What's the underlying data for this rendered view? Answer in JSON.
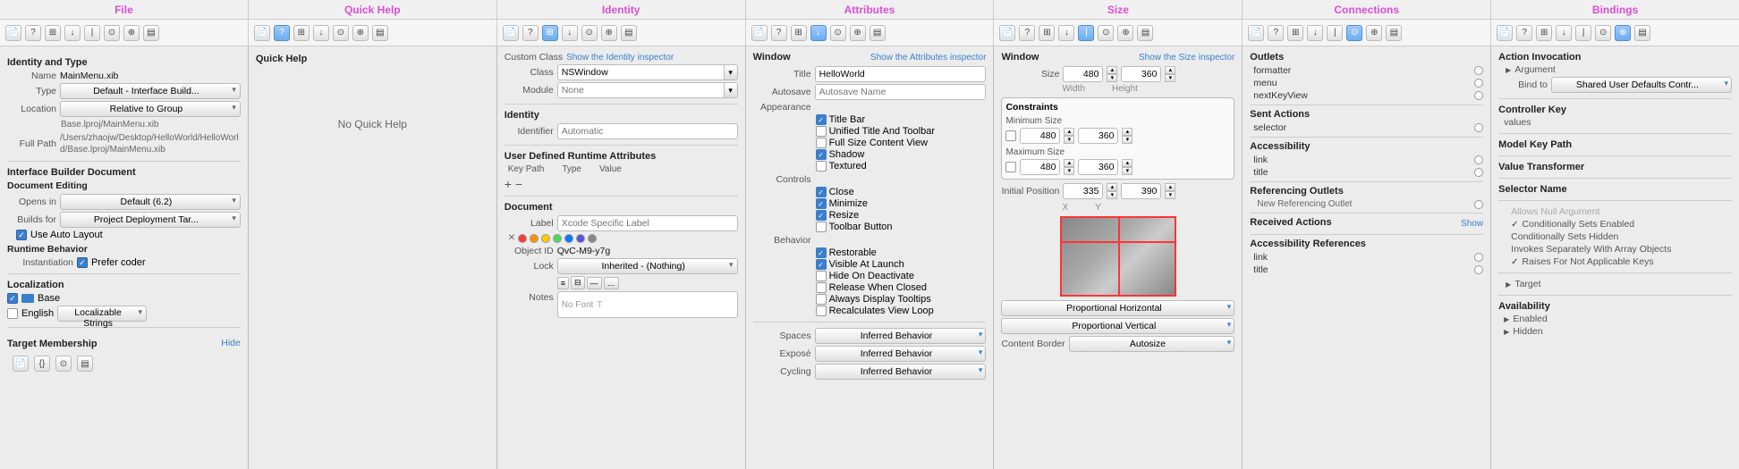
{
  "topbar": {
    "sections": [
      "File",
      "Quick Help",
      "Identity",
      "Attributes",
      "Size",
      "Connections",
      "Bindings"
    ]
  },
  "file_panel": {
    "title": "Identity and Type",
    "name_label": "Name",
    "name_value": "MainMenu.xib",
    "type_label": "Type",
    "type_value": "Default - Interface Build...",
    "location_label": "Location",
    "location_value": "Relative to Group",
    "base_path": "Base.lproj/MainMenu.xib",
    "full_path_label": "Full Path",
    "full_path_value": "/Users/zhaojw/Desktop/HelloWorld/HelloWorld/Base.lproj/MainMenu.xib",
    "ibd_title": "Interface Builder Document",
    "doc_editing_title": "Document Editing",
    "opens_in_label": "Opens in",
    "opens_in_value": "Default (6.2)",
    "builds_for_label": "Builds for",
    "builds_for_value": "Project Deployment Tar...",
    "use_auto_layout": "Use Auto Layout",
    "runtime_title": "Runtime Behavior",
    "instantiation_label": "Instantiation",
    "prefer_coder": "Prefer coder",
    "localization_title": "Localization",
    "base_label": "Base",
    "english_label": "English",
    "localizable_strings": "Localizable Strings",
    "target_membership_title": "Target Membership",
    "hide_label": "Hide"
  },
  "quick_help": {
    "title": "Quick Help",
    "no_help": "No Quick Help"
  },
  "identity_panel": {
    "custom_class_label": "Custom Class",
    "show_identity": "Show the Identity inspector",
    "class_label": "Class",
    "class_value": "NSWindow",
    "module_label": "Module",
    "module_value": "None",
    "identity_title": "Identity",
    "identifier_label": "Identifier",
    "identifier_placeholder": "Automatic",
    "udra_title": "User Defined Runtime Attributes",
    "key_path_col": "Key Path",
    "type_col": "Type",
    "value_col": "Value",
    "document_title": "Document",
    "label_label": "Label",
    "label_placeholder": "Xcode Specific Label",
    "object_id_label": "Object ID",
    "object_id_value": "QvC-M9-y7g",
    "lock_label": "Lock",
    "lock_value": "Inherited - (Nothing)",
    "notes_label": "Notes",
    "no_font": "No Font",
    "plus": "+",
    "minus": "−"
  },
  "attributes_panel": {
    "window_label": "Window",
    "show_attributes": "Show the Attributes inspector",
    "title_label": "Title",
    "title_value": "HelloWorld",
    "autosave_label": "Autosave",
    "autosave_placeholder": "Autosave Name",
    "appearance_label": "Appearance",
    "title_bar": "Title Bar",
    "unified_title": "Unified Title And Toolbar",
    "full_size": "Full Size Content View",
    "shadow": "Shadow",
    "textured": "Textured",
    "controls_label": "Controls",
    "close": "Close",
    "minimize": "Minimize",
    "resize": "Resize",
    "toolbar_button": "Toolbar Button",
    "behavior_label": "Behavior",
    "restorable": "Restorable",
    "visible_at_launch": "Visible At Launch",
    "hide_on_deactivate": "Hide On Deactivate",
    "release_when_closed": "Release When Closed",
    "always_display_tooltips": "Always Display Tooltips",
    "recalculates_view_loop": "Recalculates View Loop",
    "spaces_label": "Spaces",
    "spaces_value": "Inferred Behavior",
    "expose_label": "Exposé",
    "expose_value": "Inferred Behavior",
    "cycling_label": "Cycling",
    "cycling_value": "Inferred Behavior"
  },
  "size_panel": {
    "window_label": "Window",
    "show_size": "Show the Size inspector",
    "size_label": "Size",
    "width_value": "480",
    "height_value": "360",
    "width_label": "Width",
    "height_label": "Height",
    "constraints_label": "Constraints",
    "minimum_size": "Minimum Size",
    "min_width": "480",
    "min_height": "360",
    "maximum_size": "Maximum Size",
    "max_width": "480",
    "max_height": "360",
    "initial_position_label": "Initial Position",
    "x_value": "335",
    "y_value": "390",
    "x_label": "X",
    "y_label": "Y",
    "proportional_h": "Proportional Horizontal",
    "proportional_v": "Proportional Vertical",
    "content_border_label": "Content Border",
    "content_border_value": "Autosize"
  },
  "connections_panel": {
    "outlets_title": "Outlets",
    "formatter": "formatter",
    "menu": "menu",
    "next_key_view": "nextKeyView",
    "sent_actions_title": "Sent Actions",
    "selector": "selector",
    "accessibility_title": "Accessibility",
    "link": "link",
    "title": "title",
    "referencing_outlets_title": "Referencing Outlets",
    "new_referencing_outlet": "New Referencing Outlet",
    "received_actions_title": "Received Actions",
    "show_label": "Show",
    "accessibility_refs_title": "Accessibility References",
    "link2": "link",
    "title2": "title"
  },
  "bindings_panel": {
    "action_invocation_title": "Action Invocation",
    "argument_label": "Argument",
    "bind_to_label": "Bind to",
    "bind_to_value": "Shared User Defaults Contr...",
    "controller_key_title": "Controller Key",
    "values_label": "values",
    "model_key_path_title": "Model Key Path",
    "value_transformer_title": "Value Transformer",
    "selector_name_title": "Selector Name",
    "allows_null": "Allows Null Argument",
    "conditionally_enabled": "Conditionally Sets Enabled",
    "conditionally_hidden": "Conditionally Sets Hidden",
    "invokes_separately": "Invokes Separately With Array Objects",
    "raises_not_applicable": "Raises For Not Applicable Keys",
    "target_label": "Target",
    "availability_title": "Availability",
    "enabled_label": "Enabled",
    "hidden_label": "Hidden"
  }
}
